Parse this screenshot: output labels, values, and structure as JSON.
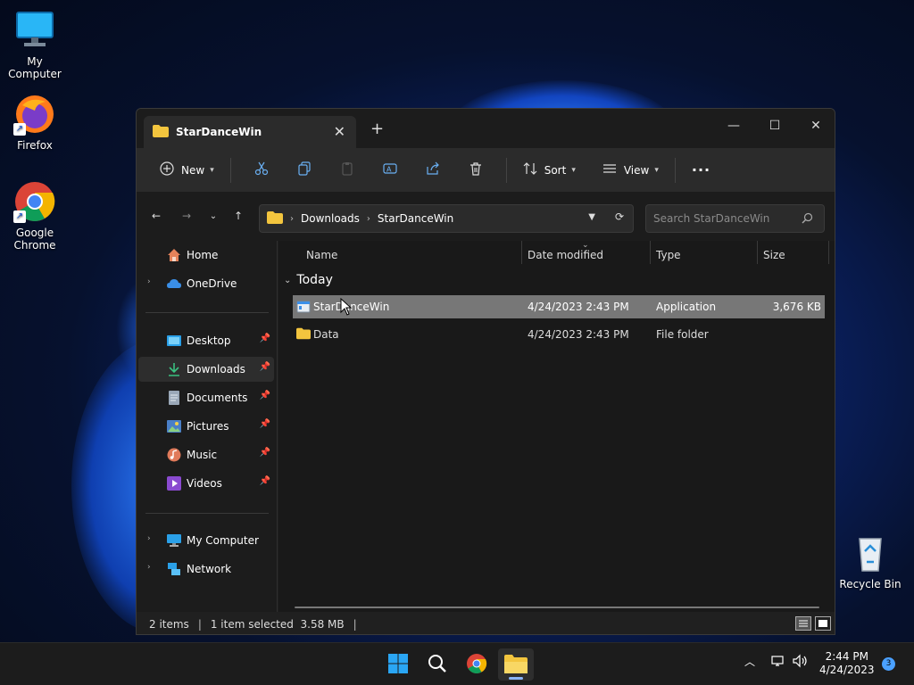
{
  "desktop": {
    "icons": [
      {
        "label": "My Computer"
      },
      {
        "label": "Firefox"
      },
      {
        "label": "Google Chrome"
      },
      {
        "label": "Recycle Bin"
      }
    ]
  },
  "window": {
    "tab_title": "StarDanceWin",
    "toolbar": {
      "new_label": "New",
      "sort_label": "Sort",
      "view_label": "View",
      "more_label": "···"
    },
    "address": {
      "crumbs": [
        "Downloads",
        "StarDanceWin"
      ]
    },
    "search": {
      "placeholder": "Search StarDanceWin"
    },
    "sidebar": {
      "items": [
        {
          "label": "Home"
        },
        {
          "label": "OneDrive"
        },
        {
          "label": "Desktop"
        },
        {
          "label": "Downloads"
        },
        {
          "label": "Documents"
        },
        {
          "label": "Pictures"
        },
        {
          "label": "Music"
        },
        {
          "label": "Videos"
        },
        {
          "label": "My Computer"
        },
        {
          "label": "Network"
        }
      ]
    },
    "columns": [
      "Name",
      "Date modified",
      "Type",
      "Size"
    ],
    "group_label": "Today",
    "rows": [
      {
        "name": "StarDanceWin",
        "date": "4/24/2023 2:43 PM",
        "type": "Application",
        "size": "3,676 KB"
      },
      {
        "name": "Data",
        "date": "4/24/2023 2:43 PM",
        "type": "File folder",
        "size": ""
      }
    ],
    "status": {
      "items": "2 items",
      "selected": "1 item selected  3.58 MB"
    }
  },
  "taskbar": {
    "clock_time": "2:44 PM",
    "clock_date": "4/24/2023",
    "notification_count": "3"
  },
  "colors": {
    "accent": "#0078d4",
    "folder": "#f3c53e",
    "selection": "#777777"
  }
}
